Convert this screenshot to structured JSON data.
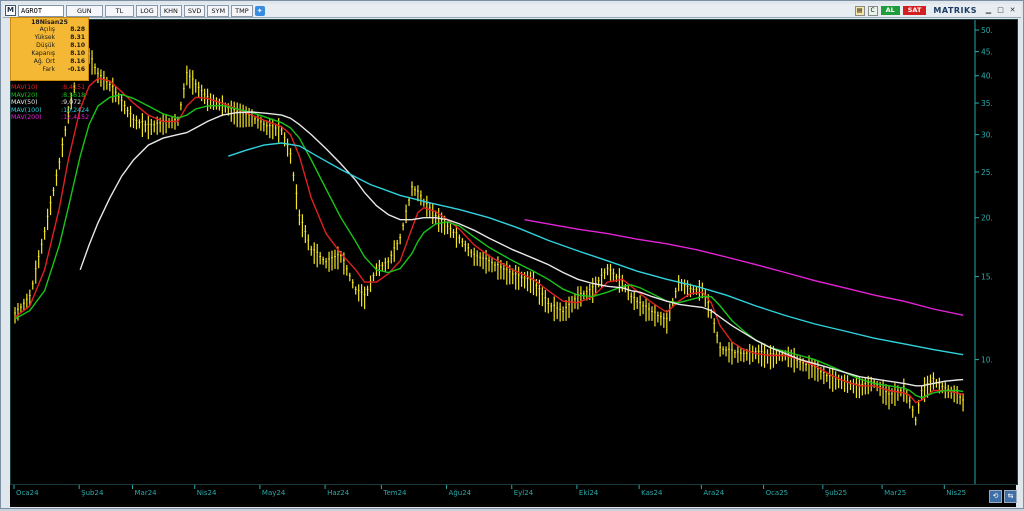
{
  "toolbar": {
    "logo": "M",
    "symbol": "AGROT",
    "buttons": [
      "GUN",
      "TL",
      "LOG",
      "KHN",
      "SVD",
      "SYM",
      "TMP"
    ],
    "buy_label": "AL",
    "sell_label": "SAT",
    "brand": "MATRIKS",
    "small_buttons": [
      "C",
      "S"
    ]
  },
  "info_box": {
    "date": "18Nisan25",
    "rows": [
      {
        "label": "Açılış",
        "value": "8.28"
      },
      {
        "label": "Yüksek",
        "value": "8.31"
      },
      {
        "label": "Düşük",
        "value": "8.10"
      },
      {
        "label": "Kapanış",
        "value": "8.10"
      },
      {
        "label": "Ağ. Ort",
        "value": "8.16"
      },
      {
        "label": "Fark",
        "value": "-0.16"
      }
    ]
  },
  "moving_averages": [
    {
      "name": "MAV(10)",
      "value": ":8,4151",
      "color": "#e02020"
    },
    {
      "name": "MAV(20)",
      "value": ":8,5618",
      "color": "#19c419"
    },
    {
      "name": "MAV(50)",
      "value": ":9,072",
      "color": "#e8e8e8"
    },
    {
      "name": "MAV(100)",
      "value": ":10,2424",
      "color": "#2fd3de"
    },
    {
      "name": "MAV(200)",
      "value": ":12,4152",
      "color": "#e323d6"
    }
  ],
  "colors": {
    "background": "#000000",
    "candles": "#f2e526",
    "axis": "#2aa9a9"
  },
  "chart_data": {
    "type": "line",
    "title": "",
    "xlabel": "",
    "ylabel": "",
    "y_scale": "log",
    "ylim": [
      5.5,
      52
    ],
    "y_ticks": [
      50,
      45,
      40,
      35,
      30,
      25,
      20,
      15,
      10
    ],
    "x_ticks": [
      "Oca24",
      "Şub24",
      "Mar24",
      "Nis24",
      "May24",
      "Haz24",
      "Tem24",
      "Ağu24",
      "Eyl24",
      "Eki24",
      "Kas24",
      "Ara24",
      "Oca25",
      "Şub25",
      "Mar25",
      "Nis25"
    ],
    "x_tick_index": [
      0,
      22,
      40,
      61,
      83,
      105,
      124,
      146,
      168,
      190,
      211,
      232,
      253,
      273,
      293,
      314
    ],
    "series": [
      {
        "name": "Price",
        "color": "#f2e526",
        "x": [
          0,
          5,
          10,
          15,
          18,
          22,
          25,
          28,
          32,
          36,
          40,
          45,
          50,
          55,
          58,
          61,
          65,
          70,
          75,
          80,
          85,
          90,
          93,
          96,
          100,
          105,
          110,
          115,
          118,
          122,
          126,
          130,
          134,
          136,
          138,
          142,
          146,
          150,
          155,
          160,
          168,
          175,
          180,
          185,
          190,
          195,
          200,
          205,
          208,
          211,
          215,
          220,
          224,
          228,
          232,
          235,
          238,
          242,
          246,
          250,
          255,
          260,
          265,
          270,
          275,
          280,
          285,
          290,
          295,
          300,
          302,
          304,
          306,
          310,
          314,
          318,
          320
        ],
        "values": [
          12.4,
          13.5,
          18.5,
          26.0,
          33.0,
          43.0,
          44.0,
          40.0,
          38.0,
          35.0,
          32.0,
          31.0,
          31.5,
          32.0,
          40.0,
          38.0,
          35.5,
          34.5,
          33.0,
          32.5,
          31.0,
          30.5,
          27.0,
          20.0,
          17.0,
          16.0,
          16.5,
          14.0,
          13.5,
          15.5,
          16.0,
          18.0,
          23.0,
          22.5,
          21.5,
          20.0,
          19.0,
          18.0,
          16.5,
          16.0,
          15.0,
          14.5,
          13.0,
          12.5,
          13.5,
          14.0,
          15.5,
          14.5,
          13.5,
          13.0,
          12.5,
          12.0,
          14.5,
          14.0,
          14.0,
          12.5,
          10.5,
          10.3,
          10.2,
          10.3,
          10.1,
          10.2,
          9.8,
          9.5,
          9.1,
          8.9,
          8.7,
          8.9,
          8.3,
          8.6,
          8.1,
          7.4,
          8.5,
          9.0,
          8.6,
          8.4,
          8.1
        ]
      },
      {
        "name": "MAV(10)",
        "color": "#e02020",
        "x": [
          0,
          5,
          10,
          15,
          18,
          22,
          25,
          28,
          32,
          36,
          40,
          45,
          50,
          55,
          58,
          61,
          65,
          70,
          75,
          80,
          85,
          90,
          93,
          96,
          100,
          105,
          110,
          115,
          118,
          122,
          126,
          130,
          134,
          136,
          138,
          142,
          146,
          150,
          155,
          160,
          168,
          175,
          180,
          185,
          190,
          195,
          200,
          205,
          208,
          211,
          215,
          220,
          224,
          228,
          232,
          235,
          238,
          242,
          246,
          250,
          255,
          260,
          265,
          270,
          275,
          280,
          285,
          290,
          295,
          300,
          302,
          304,
          306,
          310,
          314,
          318,
          320
        ],
        "values": [
          12.3,
          13.0,
          15.5,
          21.0,
          26.5,
          34.0,
          38.0,
          39.5,
          39.0,
          37.0,
          35.0,
          33.0,
          32.0,
          32.0,
          34.5,
          36.0,
          35.8,
          35.0,
          34.0,
          33.0,
          32.0,
          31.2,
          30.0,
          27.0,
          22.0,
          18.5,
          16.8,
          15.5,
          14.6,
          14.6,
          15.2,
          16.2,
          19.0,
          20.5,
          21.0,
          20.6,
          19.8,
          18.9,
          17.5,
          16.6,
          15.5,
          14.8,
          14.0,
          13.3,
          13.2,
          13.6,
          14.6,
          14.8,
          14.3,
          13.8,
          13.2,
          12.6,
          13.3,
          13.8,
          13.9,
          13.2,
          11.8,
          10.9,
          10.5,
          10.3,
          10.2,
          10.2,
          10.0,
          9.7,
          9.3,
          9.0,
          8.8,
          8.8,
          8.6,
          8.5,
          8.4,
          8.1,
          8.2,
          8.6,
          8.6,
          8.5,
          8.42
        ]
      },
      {
        "name": "MAV(20)",
        "color": "#19c419",
        "x": [
          0,
          5,
          10,
          15,
          18,
          22,
          25,
          28,
          32,
          36,
          40,
          45,
          50,
          55,
          58,
          61,
          65,
          70,
          75,
          80,
          85,
          90,
          93,
          96,
          100,
          105,
          110,
          115,
          118,
          122,
          126,
          130,
          134,
          136,
          138,
          142,
          146,
          150,
          155,
          160,
          168,
          175,
          180,
          185,
          190,
          195,
          200,
          205,
          208,
          211,
          215,
          220,
          224,
          228,
          232,
          235,
          238,
          242,
          246,
          250,
          255,
          260,
          265,
          270,
          275,
          280,
          285,
          290,
          295,
          300,
          302,
          304,
          306,
          310,
          314,
          318,
          320
        ],
        "values": [
          12.2,
          12.7,
          14.0,
          17.5,
          21.0,
          27.0,
          31.5,
          34.5,
          36.0,
          36.5,
          35.8,
          34.5,
          33.2,
          32.5,
          33.0,
          34.0,
          34.5,
          34.6,
          34.0,
          33.4,
          32.6,
          31.8,
          31.0,
          29.5,
          26.5,
          23.0,
          20.0,
          17.8,
          16.5,
          15.5,
          15.3,
          15.6,
          16.8,
          17.8,
          18.6,
          19.4,
          19.6,
          19.2,
          18.2,
          17.3,
          16.2,
          15.4,
          14.8,
          14.1,
          13.7,
          13.6,
          13.9,
          14.3,
          14.4,
          14.2,
          13.8,
          13.3,
          13.2,
          13.4,
          13.6,
          13.6,
          13.0,
          12.1,
          11.5,
          11.0,
          10.6,
          10.4,
          10.2,
          10.0,
          9.7,
          9.4,
          9.1,
          8.9,
          8.8,
          8.7,
          8.6,
          8.4,
          8.3,
          8.5,
          8.6,
          8.6,
          8.56
        ]
      },
      {
        "name": "MAV(50)",
        "color": "#e8e8e8",
        "x": [
          22,
          25,
          28,
          32,
          36,
          40,
          45,
          50,
          55,
          58,
          61,
          65,
          70,
          75,
          80,
          85,
          90,
          93,
          96,
          100,
          105,
          110,
          115,
          118,
          122,
          126,
          130,
          134,
          136,
          138,
          142,
          146,
          150,
          155,
          160,
          168,
          175,
          180,
          185,
          190,
          195,
          200,
          205,
          208,
          211,
          215,
          220,
          224,
          228,
          232,
          235,
          238,
          242,
          246,
          250,
          255,
          260,
          265,
          270,
          275,
          280,
          285,
          290,
          295,
          300,
          302,
          304,
          306,
          310,
          314,
          318,
          320
        ],
        "values": [
          15.5,
          17.5,
          19.5,
          22.0,
          24.5,
          26.5,
          28.5,
          29.5,
          30.0,
          30.3,
          31.0,
          32.0,
          33.0,
          33.4,
          33.5,
          33.3,
          33.0,
          32.5,
          31.5,
          30.0,
          28.0,
          26.0,
          24.0,
          22.6,
          21.2,
          20.3,
          19.8,
          19.8,
          19.9,
          20.0,
          20.0,
          19.8,
          19.4,
          18.8,
          18.1,
          17.1,
          16.4,
          15.9,
          15.3,
          14.8,
          14.5,
          14.3,
          14.2,
          14.0,
          13.9,
          13.6,
          13.3,
          13.1,
          13.0,
          12.9,
          12.7,
          12.3,
          11.8,
          11.4,
          11.0,
          10.6,
          10.3,
          10.0,
          9.8,
          9.6,
          9.4,
          9.2,
          9.1,
          9.0,
          8.9,
          8.85,
          8.8,
          8.8,
          8.9,
          9.0,
          9.05,
          9.07
        ]
      },
      {
        "name": "MAV(100)",
        "color": "#2fd3de",
        "x": [
          72,
          78,
          84,
          90,
          96,
          102,
          110,
          120,
          130,
          140,
          150,
          160,
          170,
          180,
          190,
          200,
          210,
          220,
          230,
          240,
          250,
          260,
          270,
          280,
          290,
          300,
          310,
          320
        ],
        "values": [
          27.0,
          27.8,
          28.5,
          28.8,
          28.4,
          27.0,
          25.3,
          23.5,
          22.3,
          21.5,
          20.8,
          20.0,
          19.0,
          17.9,
          17.0,
          16.2,
          15.4,
          14.8,
          14.3,
          13.7,
          13.0,
          12.4,
          11.9,
          11.5,
          11.1,
          10.8,
          10.5,
          10.24
        ]
      },
      {
        "name": "MAV(200)",
        "color": "#e323d6",
        "x": [
          172,
          180,
          190,
          200,
          210,
          220,
          230,
          240,
          250,
          260,
          270,
          280,
          290,
          300,
          310,
          320
        ],
        "values": [
          19.8,
          19.4,
          18.9,
          18.5,
          18.0,
          17.6,
          17.1,
          16.5,
          15.9,
          15.3,
          14.7,
          14.2,
          13.7,
          13.3,
          12.8,
          12.42
        ]
      }
    ]
  }
}
